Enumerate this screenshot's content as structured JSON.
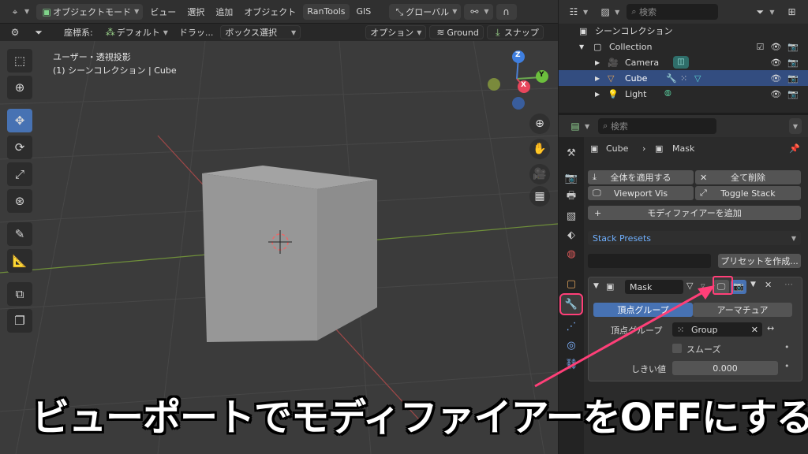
{
  "header": {
    "mode": "オブジェクトモード",
    "menus": [
      "ビュー",
      "選択",
      "追加",
      "オブジェクト",
      "RanTools",
      "GIS"
    ],
    "orientation": "グローバル"
  },
  "tool_header": {
    "coord_label": "座標系:",
    "coord_value": "デフォルト",
    "drag_label": "ドラッ...",
    "drag_value": "ボックス選択",
    "options": "オプション",
    "ground": "Ground",
    "snap": "スナップ"
  },
  "viewport": {
    "label_line1": "ユーザー・透視投影",
    "label_line2": "(1) シーンコレクション | Cube",
    "gizmo": {
      "x": "X",
      "y": "Y",
      "z": "Z"
    }
  },
  "outliner": {
    "search_placeholder": "検索",
    "scene_collection": "シーンコレクション",
    "items": [
      {
        "label": "Collection"
      },
      {
        "label": "Camera"
      },
      {
        "label": "Cube"
      },
      {
        "label": "Light"
      }
    ]
  },
  "properties": {
    "search_placeholder": "検索",
    "breadcrumb_object": "Cube",
    "breadcrumb_modifier": "Mask",
    "apply_all": "全体を適用する",
    "delete_all": "全て削除",
    "viewport_vis": "Viewport Vis",
    "toggle_stack": "Toggle Stack",
    "add_modifier": "モディファイアーを追加",
    "stack_presets": "Stack Presets",
    "create_preset": "プリセットを作成...",
    "modifier": {
      "name": "Mask",
      "mode_vertex_group": "頂点グループ",
      "mode_armature": "アーマチュア",
      "vertex_group_label": "頂点グループ",
      "vertex_group_value": "Group",
      "smooth_label": "スムーズ",
      "threshold_label": "しきい値",
      "threshold_value": "0.000"
    }
  },
  "caption": "ビューポートでモディファイアーをOFFにする",
  "colors": {
    "accent_blue": "#4772b3",
    "highlight_pink": "#ff3f78",
    "selected_row": "#334d80"
  }
}
